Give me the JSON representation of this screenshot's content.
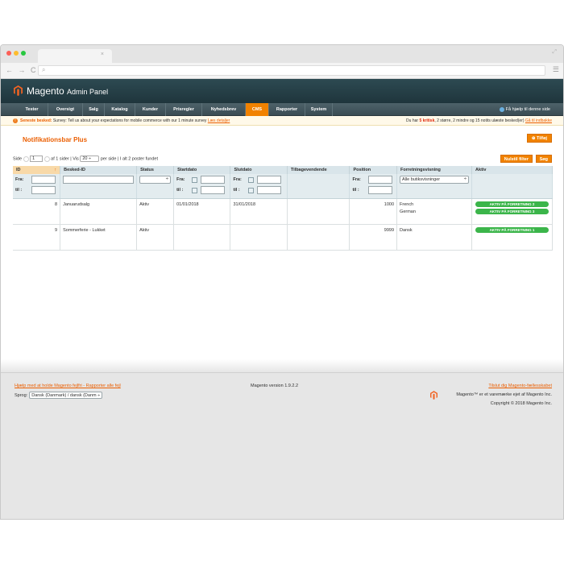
{
  "browser": {
    "tab_close": "×",
    "expand_icon": "⤢",
    "nav_buttons": "← → C",
    "search_glyph": "⌕",
    "menu_glyph": "☰"
  },
  "header": {
    "brand": "Magento",
    "brand_sub": "Admin Panel",
    "brand_color": "#f26322"
  },
  "nav": {
    "items": [
      "Tester",
      "Oversigt",
      "Salg",
      "Katalog",
      "Kunder",
      "Prisregler",
      "Nyhedsbrev",
      "CMS",
      "Rapporter",
      "System"
    ],
    "active": "CMS",
    "help": "Få hjælp til denne side"
  },
  "notice": {
    "icon": "!",
    "label": "Seneste besked:",
    "text": " Survey: Tell us about your expectations for mobile commerce with our 1 minute survey ",
    "link": "Læs detaljer",
    "right_prefix": "Du har ",
    "critical": "5 kritisk",
    "right_rest": ", 2 større, 2 mindre og 15 notits ulæste besked(er) ",
    "right_link": "Gå til indbakke"
  },
  "page": {
    "title": "Notifikationsbar Plus",
    "add_button": "⊕ Tilføj"
  },
  "pager": {
    "prefix": "Side",
    "page": "1",
    "of_pages": "af 1 sider  |  Vis",
    "per_page": "20",
    "suffix": "per side  |  I alt 2 poster fundet",
    "reset_button": "Nulstil filter",
    "search_button": "Søg"
  },
  "grid": {
    "columns": [
      "ID",
      "Besked-ID",
      "Status",
      "Startdato",
      "Slutdato",
      "Tilbagevendende",
      "Position",
      "Forretningsvisning",
      "Aktiv"
    ],
    "sort_indicator": "↑",
    "filter_from": "Fra:",
    "filter_to": "til :",
    "store_filter": "Alle butiksvisninger",
    "rows": [
      {
        "id": "8",
        "name": "Januarudsalg",
        "status": "Aktiv",
        "start": "01/01/2018",
        "end": "31/01/2018",
        "recurring": "",
        "position": "1000",
        "stores": [
          "French",
          "German"
        ],
        "badges": [
          "AKTIV PÅ FORRETNING 2",
          "AKTIV PÅ FORRETNING 3"
        ]
      },
      {
        "id": "9",
        "name": "Sommerferie - Lukket",
        "status": "Aktiv",
        "start": "",
        "end": "",
        "recurring": "",
        "position": "9999",
        "stores": [
          "Dansk"
        ],
        "badges": [
          "AKTIV PÅ FORRETNING 1"
        ]
      }
    ]
  },
  "footer": {
    "help_link": "Hjælp med at holde Magento fejlfri - Rapporter alle fejl",
    "lang_label": "Sprog:",
    "lang_value": "Dansk (Danmark) / dansk (Danm ÷",
    "version": "Magento version 1.9.2.2",
    "community_link": "Tilslut dig Magento-fællesskabet",
    "trademark": "Magento™ er et varemærke ejet af Magento Inc.",
    "copyright": "Copyright © 2018 Magento Inc."
  }
}
